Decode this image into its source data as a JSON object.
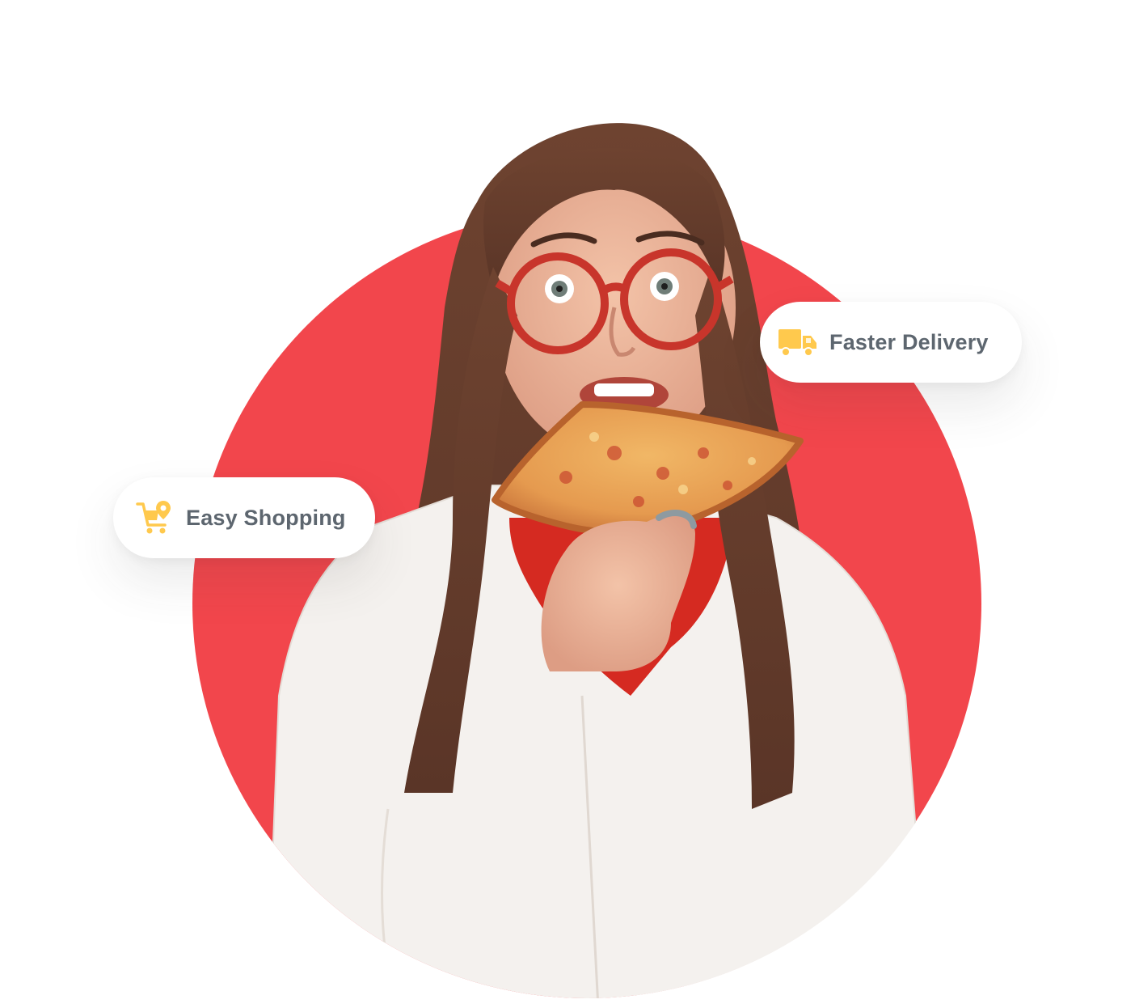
{
  "colors": {
    "accent_red": "#f2464c",
    "badge_text": "#5d666f",
    "icon_yellow": "#ffc94d"
  },
  "hero": {
    "image": "woman-eating-pizza-photo"
  },
  "badges": [
    {
      "icon": "delivery-truck-icon",
      "label": "Faster Delivery"
    },
    {
      "icon": "shopping-cart-location-icon",
      "label": "Easy Shopping"
    }
  ]
}
